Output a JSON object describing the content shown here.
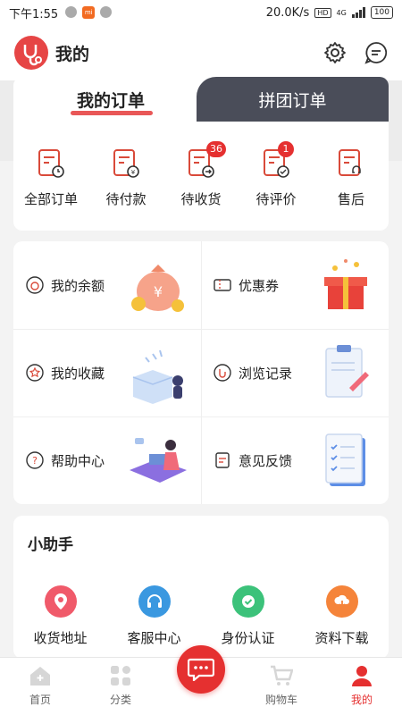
{
  "status_bar": {
    "time": "下午1:55",
    "mi_label": "mi",
    "network_speed": "20.0K/s",
    "hd": "HD",
    "network_type": "4G",
    "battery": "100"
  },
  "header": {
    "title": "我的"
  },
  "orders": {
    "tabs": [
      {
        "label": "我的订单",
        "active": true
      },
      {
        "label": "拼团订单",
        "active": false
      }
    ],
    "items": [
      {
        "label": "全部订单",
        "badge": ""
      },
      {
        "label": "待付款",
        "badge": ""
      },
      {
        "label": "待收货",
        "badge": "36"
      },
      {
        "label": "待评价",
        "badge": "1"
      },
      {
        "label": "售后",
        "badge": ""
      }
    ]
  },
  "services": [
    {
      "label": "我的余额",
      "icon": "money-bag-icon"
    },
    {
      "label": "优惠券",
      "icon": "coupon-icon"
    },
    {
      "label": "我的收藏",
      "icon": "star-icon"
    },
    {
      "label": "浏览记录",
      "icon": "history-icon"
    },
    {
      "label": "帮助中心",
      "icon": "question-icon"
    },
    {
      "label": "意见反馈",
      "icon": "feedback-icon"
    }
  ],
  "helper": {
    "title": "小助手",
    "items": [
      {
        "label": "收货地址",
        "color": "#f05a6a",
        "icon": "location-icon"
      },
      {
        "label": "客服中心",
        "color": "#3a98e0",
        "icon": "headset-icon"
      },
      {
        "label": "身份认证",
        "color": "#3cc27a",
        "icon": "verified-icon"
      },
      {
        "label": "资料下载",
        "color": "#f5843a",
        "icon": "download-icon"
      }
    ]
  },
  "tabbar": {
    "items": [
      {
        "label": "首页",
        "active": false
      },
      {
        "label": "分类",
        "active": false
      },
      {
        "label": "",
        "active": false
      },
      {
        "label": "购物车",
        "active": false
      },
      {
        "label": "我的",
        "active": true
      }
    ]
  },
  "colors": {
    "accent": "#e53030",
    "dark_tab": "#4a4d59"
  }
}
